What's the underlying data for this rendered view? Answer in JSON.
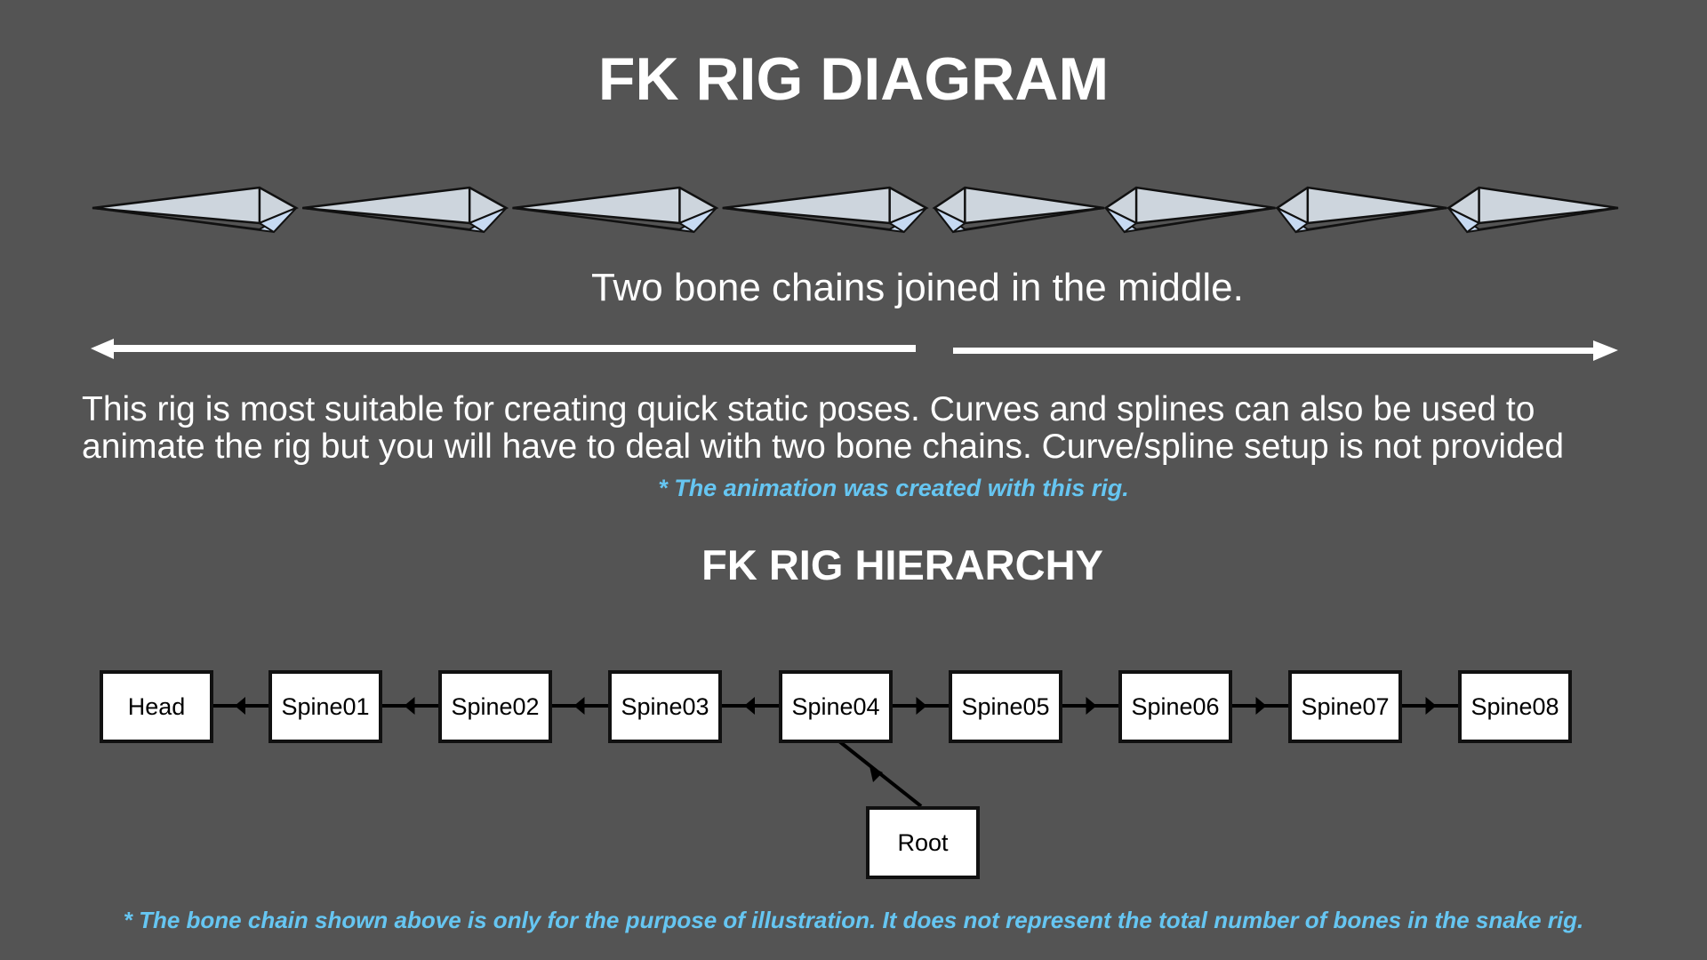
{
  "title": "FK RIG DIAGRAM",
  "bone_diagram": {
    "bone_count_per_chain": 4,
    "chains": 2,
    "bone_fill": "#cdd5dd",
    "bone_shadow": "#c7daf2",
    "outline": "#111111"
  },
  "subtitle": "Two bone chains joined in the middle.",
  "description": [
    "This rig is most suitable for creating quick static poses. Curves and splines can also be used to",
    "animate the rig but you will have to deal with two bone chains. Curve/spline setup is not provided"
  ],
  "note_animation": "* The animation was created with this rig.",
  "hierarchy": {
    "title": "FK RIG HIERARCHY",
    "nodes": [
      "Head",
      "Spine01",
      "Spine02",
      "Spine03",
      "Spine04",
      "Spine05",
      "Spine06",
      "Spine07",
      "Spine08"
    ],
    "root": "Root",
    "root_parent": "Spine04"
  },
  "footnote": "* The bone chain shown above is only for the purpose of illustration. It does not represent the total number of bones in the snake rig.",
  "colors": {
    "background": "#545454",
    "accent_note": "#66c6f2",
    "text": "#ffffff"
  }
}
